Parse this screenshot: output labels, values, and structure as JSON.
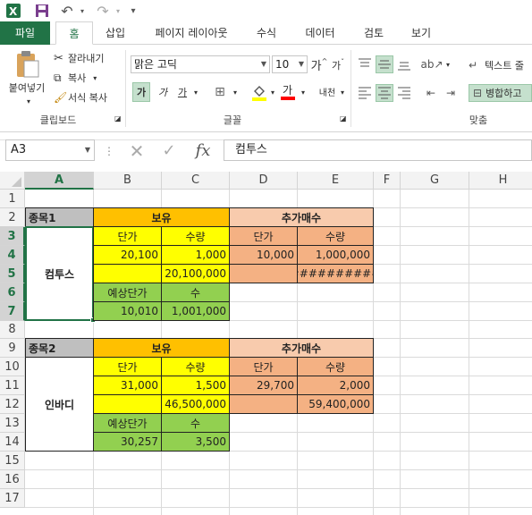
{
  "quick_access": {
    "excel_icon": "excel-icon",
    "save_icon": "save-icon",
    "undo_icon": "undo-icon",
    "redo_icon": "redo-icon",
    "customize_label": "▾"
  },
  "tabs": [
    {
      "label": "파일"
    },
    {
      "label": "홈"
    },
    {
      "label": "삽입"
    },
    {
      "label": "페이지 레이아웃"
    },
    {
      "label": "수식"
    },
    {
      "label": "데이터"
    },
    {
      "label": "검토"
    },
    {
      "label": "보기"
    }
  ],
  "ribbon": {
    "clipboard": {
      "group_label": "클립보드",
      "paste_label": "붙여넣기",
      "cut_label": "잘라내기",
      "copy_label": "복사",
      "format_painter_label": "서식 복사"
    },
    "font": {
      "group_label": "글꼴",
      "font_name": "맑은 고딕",
      "font_size": "10",
      "grow_label": "가",
      "shrink_label": "가",
      "bold_label": "가",
      "italic_label": "가",
      "underline_label": "가",
      "phonetic_label": "내천"
    },
    "alignment": {
      "group_label": "맞춤",
      "wrap_text_label": "텍스트 줄",
      "merge_label": "병합하고"
    }
  },
  "formula_bar": {
    "name_box": "A3",
    "fx_label": "fx",
    "content": "컴투스"
  },
  "columns": [
    "A",
    "B",
    "C",
    "D",
    "E",
    "F",
    "G",
    "H"
  ],
  "rows": [
    "1",
    "2",
    "3",
    "4",
    "5",
    "6",
    "7",
    "8",
    "9",
    "10",
    "11",
    "12",
    "13",
    "14",
    "15",
    "16",
    "17"
  ],
  "block1": {
    "stock_label": "종목1",
    "holding_header": "보유",
    "add_header": "추가매수",
    "price_label": "단가",
    "qty_label": "수량",
    "add_price_label": "단가",
    "add_qty_label": "수량",
    "name": "컴투스",
    "price": "20,100",
    "qty": "1,000",
    "total": "20,100,000",
    "add_price": "10,000",
    "add_qty": "1,000,000",
    "add_total": "##########",
    "est_price_label": "예상단가",
    "count_label": "수",
    "est_price": "10,010",
    "count": "1,001,000"
  },
  "block2": {
    "stock_label": "종목2",
    "holding_header": "보유",
    "add_header": "추가매수",
    "price_label": "단가",
    "qty_label": "수량",
    "add_price_label": "단가",
    "add_qty_label": "수량",
    "name": "인바디",
    "price": "31,000",
    "qty": "1,500",
    "total": "46,500,000",
    "add_price": "29,700",
    "add_qty": "2,000",
    "add_total": "59,400,000",
    "est_price_label": "예상단가",
    "count_label": "수",
    "est_price": "30,257",
    "count": "3,500"
  },
  "colors": {
    "accent": "#217346",
    "gray": "#bfbfbf",
    "orange": "#ffc000",
    "peach": "#f8cbad",
    "salmon": "#f4b183",
    "yellow": "#ffff00",
    "green": "#92d050"
  }
}
